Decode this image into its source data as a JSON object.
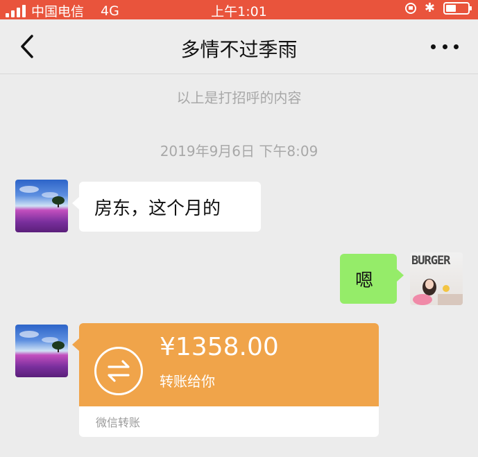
{
  "status_bar": {
    "carrier": "中国电信",
    "network": "4G",
    "time": "上午1:01"
  },
  "nav": {
    "title": "多情不过季雨",
    "back_icon": "chevron-left-icon",
    "more_icon": "more-icon"
  },
  "chat": {
    "greeting_note": "以上是打招呼的内容",
    "timestamp": "2019年9月6日 下午8:09",
    "messages": [
      {
        "side": "left",
        "text": "房东，这个月的"
      },
      {
        "side": "right",
        "text": "嗯"
      }
    ],
    "my_avatar_text": "BURGER",
    "transfer": {
      "amount": "¥1358.00",
      "description": "转账给你",
      "footer": "微信转账",
      "color": "#f0a44a"
    }
  },
  "colors": {
    "status_bar": "#e9543c",
    "background": "#ececec",
    "sent_bubble": "#95ec69",
    "received_bubble": "#ffffff"
  }
}
